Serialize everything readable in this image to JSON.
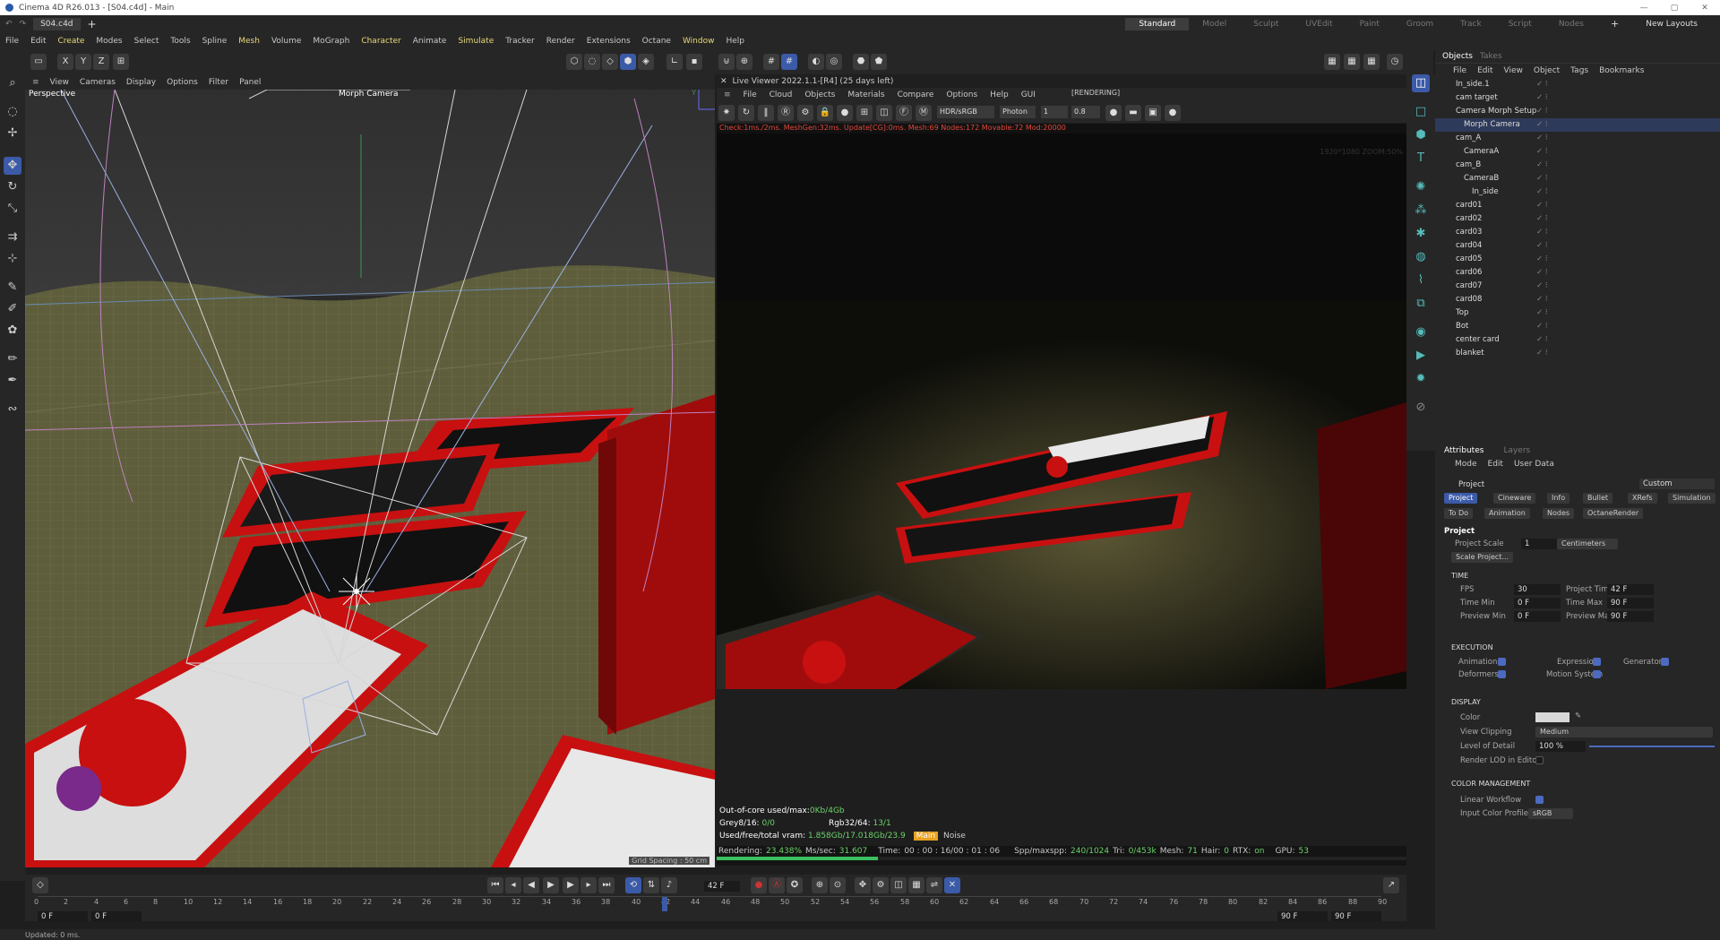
{
  "window": {
    "title": "Cinema 4D R26.013 - [S04.c4d] - Main",
    "doc_tab": "S04.c4d",
    "add_tab": "+"
  },
  "layouts": [
    "Standard",
    "Model",
    "Sculpt",
    "UVEdit",
    "Paint",
    "Groom",
    "Track",
    "Script",
    "Nodes"
  ],
  "layouts_add": "+",
  "new_layouts": "New Layouts",
  "menu": [
    "File",
    "Edit",
    "Create",
    "Modes",
    "Select",
    "Tools",
    "Spline",
    "Mesh",
    "Volume",
    "MoGraph",
    "Character",
    "Animate",
    "Simulate",
    "Tracker",
    "Render",
    "Extensions",
    "Octane",
    "Window",
    "Help"
  ],
  "axis_buttons": [
    "X",
    "Y",
    "Z"
  ],
  "viewport": {
    "menu": [
      "View",
      "Cameras",
      "Display",
      "Options",
      "Filter",
      "Panel"
    ],
    "label": "Perspective",
    "camera": "Morph Camera",
    "grid_spacing": "Grid Spacing : 50 cm"
  },
  "live_viewer": {
    "title": "Live Viewer 2022.1.1-[R4] (25 days left)",
    "menu": [
      "File",
      "Cloud",
      "Objects",
      "Materials",
      "Compare",
      "Options",
      "Help",
      "GUI"
    ],
    "state": "[RENDERING]",
    "tonemap": "HDR/sRGB",
    "kernel": "Photon",
    "value1": "1",
    "value2": "0.8",
    "status": "Check:1ms./2ms. MeshGen:32ms. Update[CG]:0ms. Mesh:69 Nodes:172 Movable:72 Mod:20000",
    "resolution": "1920*1080 ZOOM:50%",
    "info": {
      "out_of_core_label": "Out-of-core used/max:",
      "out_of_core": "0Kb/4Gb",
      "grey_label": "Grey8/16:",
      "grey": "0/0",
      "rgb_label": "Rgb32/64:",
      "rgb": "13/1",
      "vram_label": "Used/free/total vram:",
      "vram": "1.858Gb/17.018Gb/23.9",
      "main_btn": "Main",
      "noise_btn": "Noise"
    },
    "bottom": {
      "rendering_label": "Rendering:",
      "rendering": "23.438%",
      "ms_label": "Ms/sec:",
      "ms": "31.607",
      "time_label": "Time:",
      "time": "00 : 00 : 16/00 : 01 : 06",
      "spp_label": "Spp/maxspp:",
      "spp": "240/1024",
      "tri_label": "Tri:",
      "tri": "0/453k",
      "mesh_label": "Mesh:",
      "mesh": "71",
      "hair_label": "Hair:",
      "hair": "0",
      "rtx_label": "RTX:",
      "rtx": "on",
      "gpu_label": "GPU:",
      "gpu": "53",
      "progress": 0.234
    }
  },
  "objects": {
    "tabs": [
      "Objects",
      "Takes"
    ],
    "menu": [
      "File",
      "Edit",
      "View",
      "Object",
      "Tags",
      "Bookmarks"
    ],
    "items": [
      {
        "name": "In_side.1",
        "indent": 1,
        "selected": false
      },
      {
        "name": "cam target",
        "indent": 1,
        "selected": false
      },
      {
        "name": "Camera Morph Setup",
        "indent": 1,
        "selected": false
      },
      {
        "name": "Morph Camera",
        "indent": 2,
        "selected": true
      },
      {
        "name": "cam_A",
        "indent": 1,
        "selected": false
      },
      {
        "name": "CameraA",
        "indent": 2,
        "selected": false
      },
      {
        "name": "cam_B",
        "indent": 1,
        "selected": false
      },
      {
        "name": "CameraB",
        "indent": 2,
        "selected": false
      },
      {
        "name": "In_side",
        "indent": 3,
        "selected": false
      },
      {
        "name": "card01",
        "indent": 1,
        "selected": false
      },
      {
        "name": "card02",
        "indent": 1,
        "selected": false
      },
      {
        "name": "card03",
        "indent": 1,
        "selected": false
      },
      {
        "name": "card04",
        "indent": 1,
        "selected": false
      },
      {
        "name": "card05",
        "indent": 1,
        "selected": false
      },
      {
        "name": "card06",
        "indent": 1,
        "selected": false
      },
      {
        "name": "card07",
        "indent": 1,
        "selected": false
      },
      {
        "name": "card08",
        "indent": 1,
        "selected": false
      },
      {
        "name": "Top",
        "indent": 1,
        "selected": false
      },
      {
        "name": "Bot",
        "indent": 1,
        "selected": false
      },
      {
        "name": "center card",
        "indent": 1,
        "selected": false
      },
      {
        "name": "blanket",
        "indent": 1,
        "selected": false
      }
    ]
  },
  "attributes": {
    "tabs": [
      "Attributes",
      "Layers"
    ],
    "menu": [
      "Mode",
      "Edit",
      "User Data"
    ],
    "object": "Project",
    "preset": "Custom",
    "subtabs_row1": [
      "Project",
      "Cineware",
      "Info",
      "Bullet",
      "XRefs",
      "Simulation"
    ],
    "subtabs_row2": [
      "To Do",
      "Animation",
      "Nodes",
      "OctaneRender"
    ],
    "section": "Project",
    "project_scale_label": "Project Scale",
    "project_scale": "1",
    "units": "Centimeters",
    "scale_btn": "Scale Project...",
    "time": {
      "header": "TIME",
      "fps_label": "FPS",
      "fps": "30",
      "project_time_label": "Project Time",
      "project_time": "42 F",
      "time_min_label": "Time Min",
      "time_min": "0 F",
      "time_max_label": "Time Max",
      "time_max": "90 F",
      "preview_min_label": "Preview Min",
      "preview_min": "0 F",
      "preview_max_label": "Preview Max",
      "preview_max": "90 F"
    },
    "execution": {
      "header": "EXECUTION",
      "animation": "Animation",
      "expression": "Expression",
      "generators": "Generators",
      "deformers": "Deformers",
      "motion_system": "Motion System"
    },
    "display": {
      "header": "DISPLAY",
      "color_label": "Color",
      "view_clipping_label": "View Clipping",
      "view_clipping": "Medium",
      "lod_label": "Level of Detail",
      "lod": "100 %",
      "render_lod_label": "Render LOD in Editor"
    },
    "color_management": {
      "header": "COLOR MANAGEMENT",
      "linear_label": "Linear Workflow",
      "input_profile_label": "Input Color Profile",
      "input_profile": "sRGB"
    }
  },
  "timeline": {
    "current_frame": "42 F",
    "start_field": "0 F",
    "start_field2": "0 F",
    "end_field": "90 F",
    "end_field2": "90 F",
    "ticks": [
      "0",
      "2",
      "4",
      "6",
      "8",
      "10",
      "12",
      "14",
      "16",
      "18",
      "20",
      "22",
      "24",
      "26",
      "28",
      "30",
      "32",
      "34",
      "36",
      "38",
      "40",
      "42",
      "44",
      "46",
      "48",
      "50",
      "52",
      "54",
      "56",
      "58",
      "60",
      "62",
      "64",
      "66",
      "68",
      "70",
      "72",
      "74",
      "76",
      "78",
      "80",
      "82",
      "84",
      "86",
      "88",
      "90"
    ],
    "playhead_frame": 42
  },
  "status": "Updated: 0 ms.",
  "colors": {
    "accent": "#3b5aa8",
    "highlight_menu": "#e8d97a",
    "status_red": "#e0483a",
    "green": "#6bd36b",
    "felt": "#6b6b3a",
    "card_red": "#c81010"
  }
}
